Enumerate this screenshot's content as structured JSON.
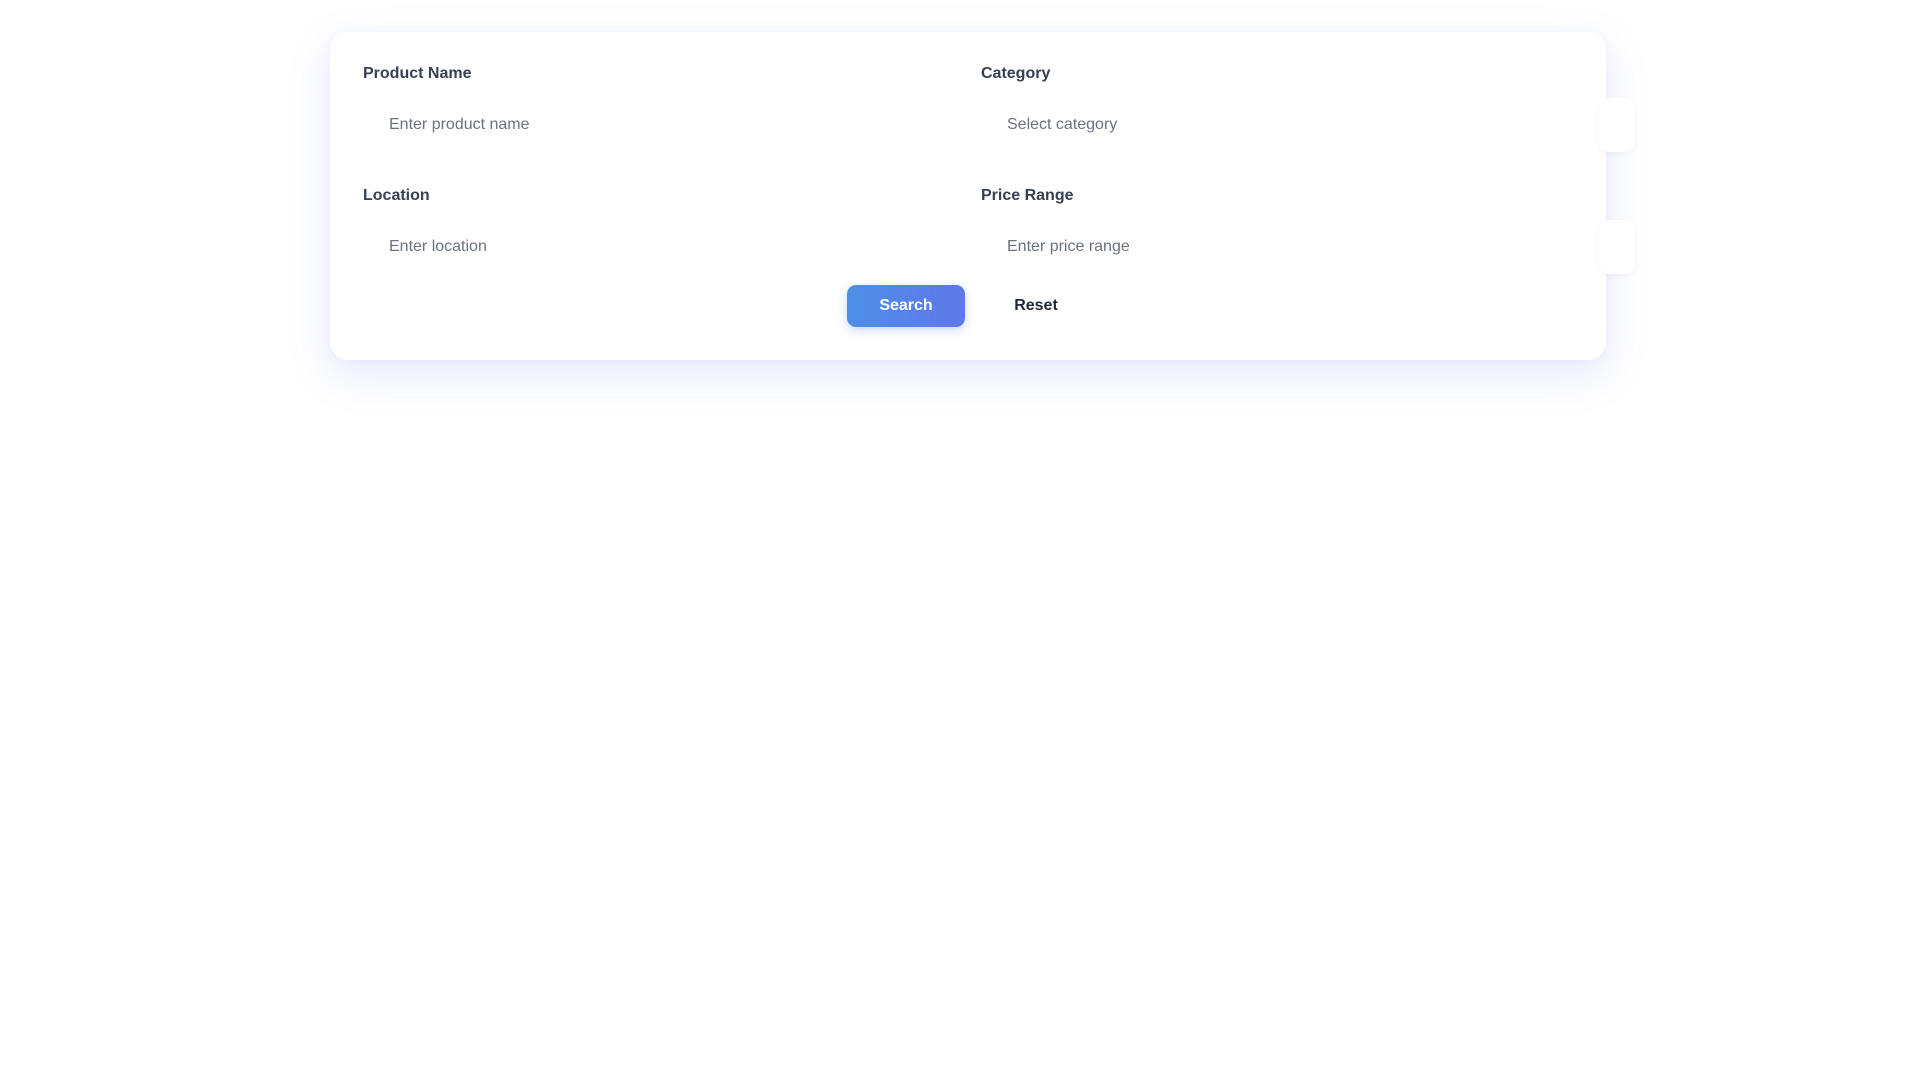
{
  "form": {
    "fields": {
      "product_name": {
        "label": "Product Name",
        "value": "",
        "placeholder": "Enter product name"
      },
      "category": {
        "label": "Category",
        "value": "",
        "placeholder": "Select category"
      },
      "location": {
        "label": "Location",
        "value": "",
        "placeholder": "Enter location"
      },
      "price_range": {
        "label": "Price Range",
        "value": "",
        "placeholder": "Enter price range"
      }
    },
    "actions": {
      "search_label": "Search",
      "reset_label": "Reset"
    }
  },
  "colors": {
    "accent_start": "#4c8fe7",
    "accent_end": "#6078e8",
    "label": "#374151",
    "placeholder": "#6b7280",
    "reset_text": "#1f2937"
  }
}
